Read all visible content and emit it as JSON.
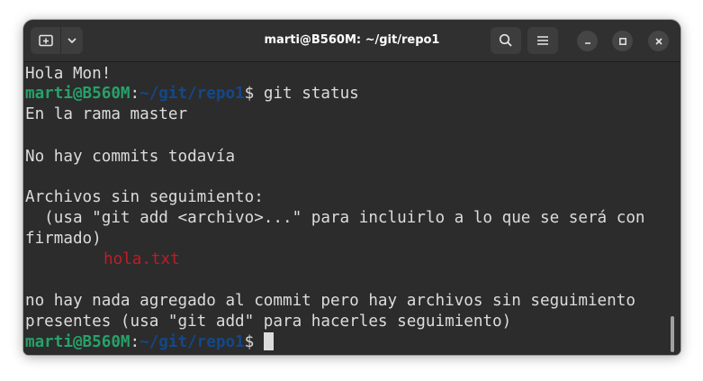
{
  "window": {
    "title": "marti@B560M: ~/git/repo1"
  },
  "titlebar": {
    "new_tab_icon": "new-tab-icon",
    "menu_dropdown_icon": "chevron-down-icon",
    "search_icon": "search-icon",
    "menu_icon": "hamburger-menu-icon",
    "minimize_icon": "minimize-icon",
    "maximize_icon": "maximize-icon",
    "close_icon": "close-icon"
  },
  "terminal": {
    "colors": {
      "background": "#2c2c2c",
      "foreground": "#dcdcdc",
      "prompt_user": "#26a269",
      "prompt_path": "#12488b",
      "untracked_file": "#c01c28"
    },
    "prompt": {
      "user_host": "marti@B560M",
      "separator": ":",
      "path": "~/git/repo1",
      "symbol": "$"
    },
    "lines": {
      "l0": "Hola Mon!",
      "l1_command": " git status",
      "l2": "En la rama master",
      "l4": "No hay commits todavía",
      "l6": "Archivos sin seguimiento:",
      "l7": "  (usa \"git add <archivo>...\" para incluirlo a lo que se será con",
      "l8": "firmado)",
      "l9_file": "hola.txt",
      "l11": "no hay nada agregado al commit pero hay archivos sin seguimiento",
      "l12": "presentes (usa \"git add\" para hacerles seguimiento)",
      "l13_command": " "
    }
  }
}
